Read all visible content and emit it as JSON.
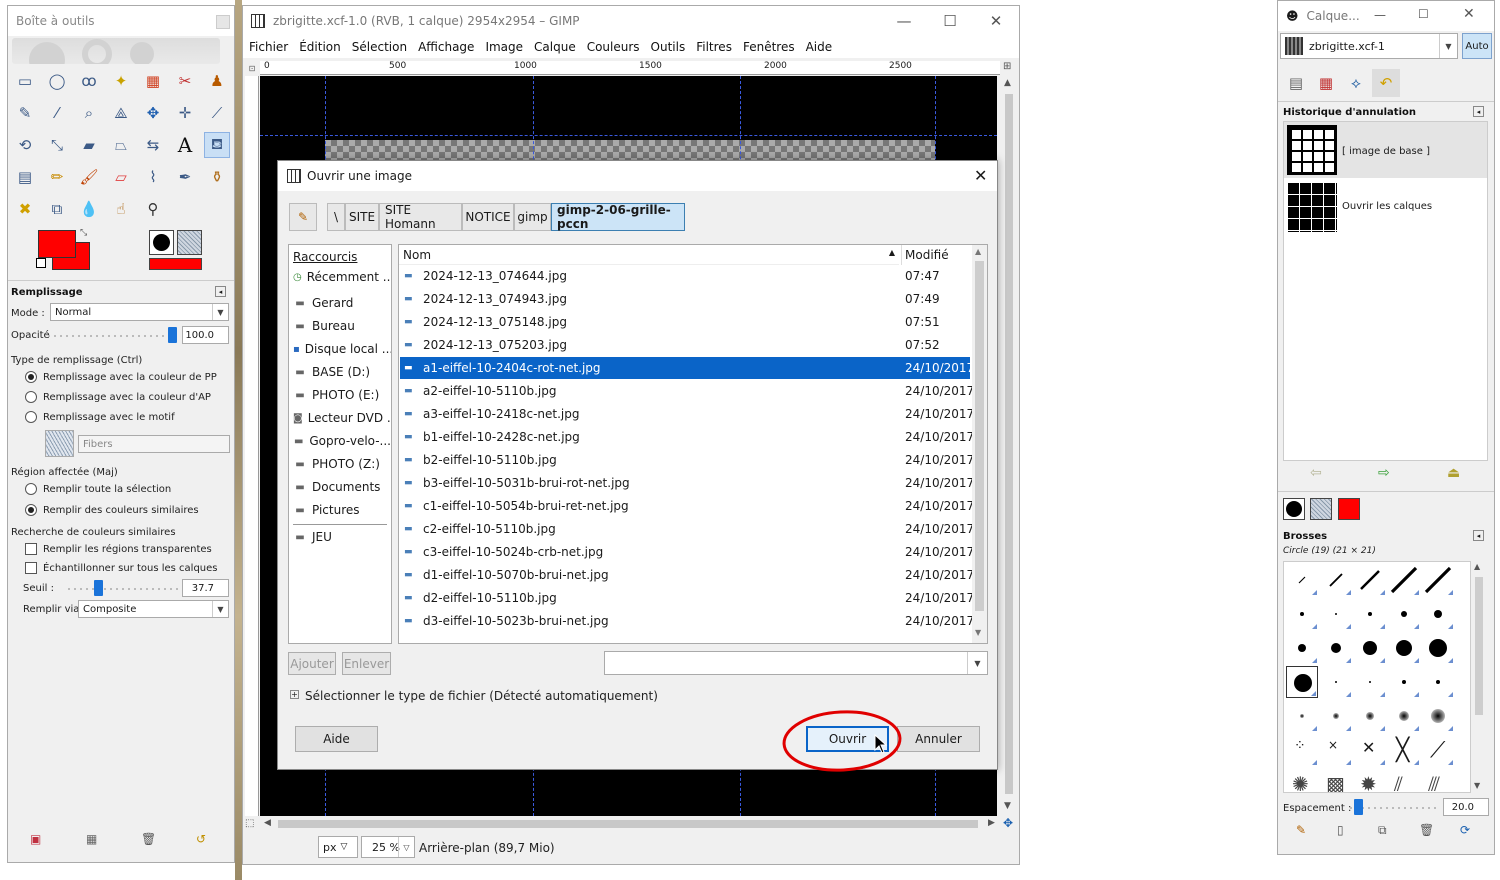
{
  "toolbox": {
    "title": "Boîte à outils",
    "fill_section": {
      "title": "Remplissage",
      "mode_label": "Mode :",
      "mode_value": "Normal",
      "opacity_label": "Opacité",
      "opacity_value": "100.0",
      "opacity_level": 1.0,
      "fill_type_label": "Type de remplissage  (Ctrl)",
      "fill_type_options": [
        {
          "label": "Remplissage avec la couleur de PP",
          "selected": true
        },
        {
          "label": "Remplissage avec la couleur d'AP",
          "selected": false
        },
        {
          "label": "Remplissage avec le motif",
          "selected": false
        }
      ],
      "pattern_name": "Fibers",
      "region_label": "Région affectée  (Maj)",
      "region_options": [
        {
          "label": "Remplir toute la sélection",
          "selected": false
        },
        {
          "label": "Remplir des couleurs similaires",
          "selected": true
        }
      ],
      "similar_label": "Recherche de couleurs similaires",
      "checkboxes": [
        {
          "label": "Remplir les régions transparentes",
          "checked": false
        },
        {
          "label": "Échantillonner sur tous les calques",
          "checked": false
        }
      ],
      "threshold_label": "Seuil :",
      "threshold_value": "37.7",
      "threshold_level": 0.148,
      "fill_via_label": "Remplir via :",
      "fill_via_value": "Composite"
    },
    "fg_color": "#ff0000",
    "bg_color": "#ff0000"
  },
  "gimp": {
    "title": "zbrigitte.xcf-1.0 (RVB, 1 calque) 2954x2954 – GIMP",
    "menus": [
      "Fichier",
      "Édition",
      "Sélection",
      "Affichage",
      "Image",
      "Calque",
      "Couleurs",
      "Outils",
      "Filtres",
      "Fenêtres",
      "Aide"
    ],
    "ruler_ticks": [
      "0",
      "500",
      "1000",
      "1500",
      "2000",
      "2500"
    ],
    "unit": "px",
    "zoom": "25 %",
    "status": "Arrière-plan (89,7 Mio)"
  },
  "dialog": {
    "title": "Ouvrir une image",
    "breadcrumbs": [
      "\\",
      "SITE",
      "SITE Homann",
      "NOTICE",
      "gimp",
      "gimp-2-06-grille-pccn"
    ],
    "places_header": "Raccourcis",
    "places": [
      {
        "icon": "recent-icon",
        "label": "Récemment ..."
      },
      {
        "icon": "folder-icon",
        "label": "Gerard"
      },
      {
        "icon": "folder-icon",
        "label": "Bureau"
      },
      {
        "icon": "drive-icon",
        "label": "Disque local ..."
      },
      {
        "icon": "drive-icon",
        "label": "BASE (D:)"
      },
      {
        "icon": "drive-icon",
        "label": "PHOTO (E:)"
      },
      {
        "icon": "drive-icon",
        "label": "Lecteur DVD ..."
      },
      {
        "icon": "drive-icon",
        "label": "Gopro-velo-..."
      },
      {
        "icon": "drive-icon",
        "label": "PHOTO (Z:)"
      },
      {
        "icon": "folder-icon",
        "label": "Documents"
      },
      {
        "icon": "folder-icon",
        "label": "Pictures"
      },
      {
        "icon": "folder-icon",
        "label": "JEU"
      }
    ],
    "columns": {
      "name": "Nom",
      "modified": "Modifié"
    },
    "files": [
      {
        "name": "2024-12-13_074644.jpg",
        "modified": "07:47",
        "selected": false
      },
      {
        "name": "2024-12-13_074943.jpg",
        "modified": "07:49",
        "selected": false
      },
      {
        "name": "2024-12-13_075148.jpg",
        "modified": "07:51",
        "selected": false
      },
      {
        "name": "2024-12-13_075203.jpg",
        "modified": "07:52",
        "selected": false
      },
      {
        "name": "a1-eiffel-10-2404c-rot-net.jpg",
        "modified": "24/10/2017",
        "selected": true
      },
      {
        "name": "a2-eiffel-10-5110b.jpg",
        "modified": "24/10/2017",
        "selected": false
      },
      {
        "name": "a3-eiffel-10-2418c-net.jpg",
        "modified": "24/10/2017",
        "selected": false
      },
      {
        "name": "b1-eiffel-10-2428c-net.jpg",
        "modified": "24/10/2017",
        "selected": false
      },
      {
        "name": "b2-eiffel-10-5110b.jpg",
        "modified": "24/10/2017",
        "selected": false
      },
      {
        "name": "b3-eiffel-10-5031b-brui-rot-net.jpg",
        "modified": "24/10/2017",
        "selected": false
      },
      {
        "name": "c1-eiffel-10-5054b-brui-ret-net.jpg",
        "modified": "24/10/2017",
        "selected": false
      },
      {
        "name": "c2-eiffel-10-5110b.jpg",
        "modified": "24/10/2017",
        "selected": false
      },
      {
        "name": "c3-eiffel-10-5024b-crb-net.jpg",
        "modified": "24/10/2017",
        "selected": false
      },
      {
        "name": "d1-eiffel-10-5070b-brui-net.jpg",
        "modified": "24/10/2017",
        "selected": false
      },
      {
        "name": "d2-eiffel-10-5110b.jpg",
        "modified": "24/10/2017",
        "selected": false
      },
      {
        "name": "d3-eiffel-10-5023b-brui-net.jpg",
        "modified": "24/10/2017",
        "selected": false
      }
    ],
    "add_label": "Ajouter",
    "remove_label": "Enlever",
    "filter_value": "",
    "filetype_label": "Sélectionner le type de fichier (Détecté automatiquement)",
    "help_label": "Aide",
    "open_label": "Ouvrir",
    "cancel_label": "Annuler"
  },
  "layers_panel": {
    "title": "Calque...",
    "image_name": "zbrigitte.xcf-1",
    "auto_label": "Auto",
    "history_title": "Historique d'annulation",
    "history": [
      "[ image de base ]",
      "Ouvrir les calques"
    ],
    "brushes_title": "Brosses",
    "brush_name": "Circle (19) (21 × 21)",
    "spacing_label": "Espacement :",
    "spacing_value": "20.0",
    "spacing_level": 0.1
  },
  "colors": {
    "accent": "#0a64c8",
    "annotation": "#e00000"
  }
}
